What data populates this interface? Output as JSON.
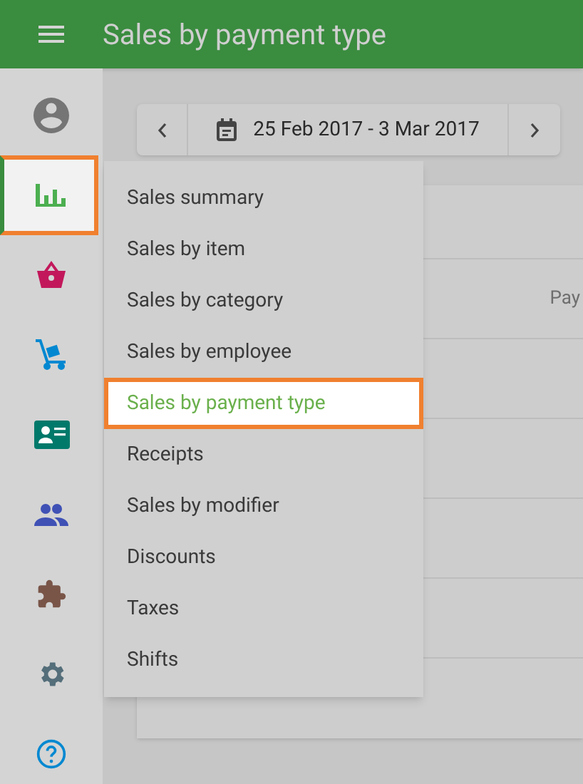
{
  "app_bar": {
    "title": "Sales by payment type"
  },
  "date_range": {
    "label": "25 Feb 2017 - 3 Mar 2017"
  },
  "sidebar": {
    "items": [
      {
        "kind": "account",
        "selected": false
      },
      {
        "kind": "reports",
        "selected": true
      },
      {
        "kind": "items",
        "selected": false
      },
      {
        "kind": "inventory",
        "selected": false
      },
      {
        "kind": "employees",
        "selected": false
      },
      {
        "kind": "customers",
        "selected": false
      },
      {
        "kind": "integrations",
        "selected": false
      },
      {
        "kind": "settings",
        "selected": false
      },
      {
        "kind": "help",
        "selected": false
      }
    ]
  },
  "report": {
    "column_2_header": "Pay"
  },
  "menu": {
    "items": [
      {
        "label": "Sales summary",
        "selected": false
      },
      {
        "label": "Sales by item",
        "selected": false
      },
      {
        "label": "Sales by category",
        "selected": false
      },
      {
        "label": "Sales by employee",
        "selected": false
      },
      {
        "label": "Sales by payment type",
        "selected": true
      },
      {
        "label": "Receipts",
        "selected": false
      },
      {
        "label": "Sales by modifier",
        "selected": false
      },
      {
        "label": "Discounts",
        "selected": false
      },
      {
        "label": "Taxes",
        "selected": false
      },
      {
        "label": "Shifts",
        "selected": false
      }
    ]
  }
}
